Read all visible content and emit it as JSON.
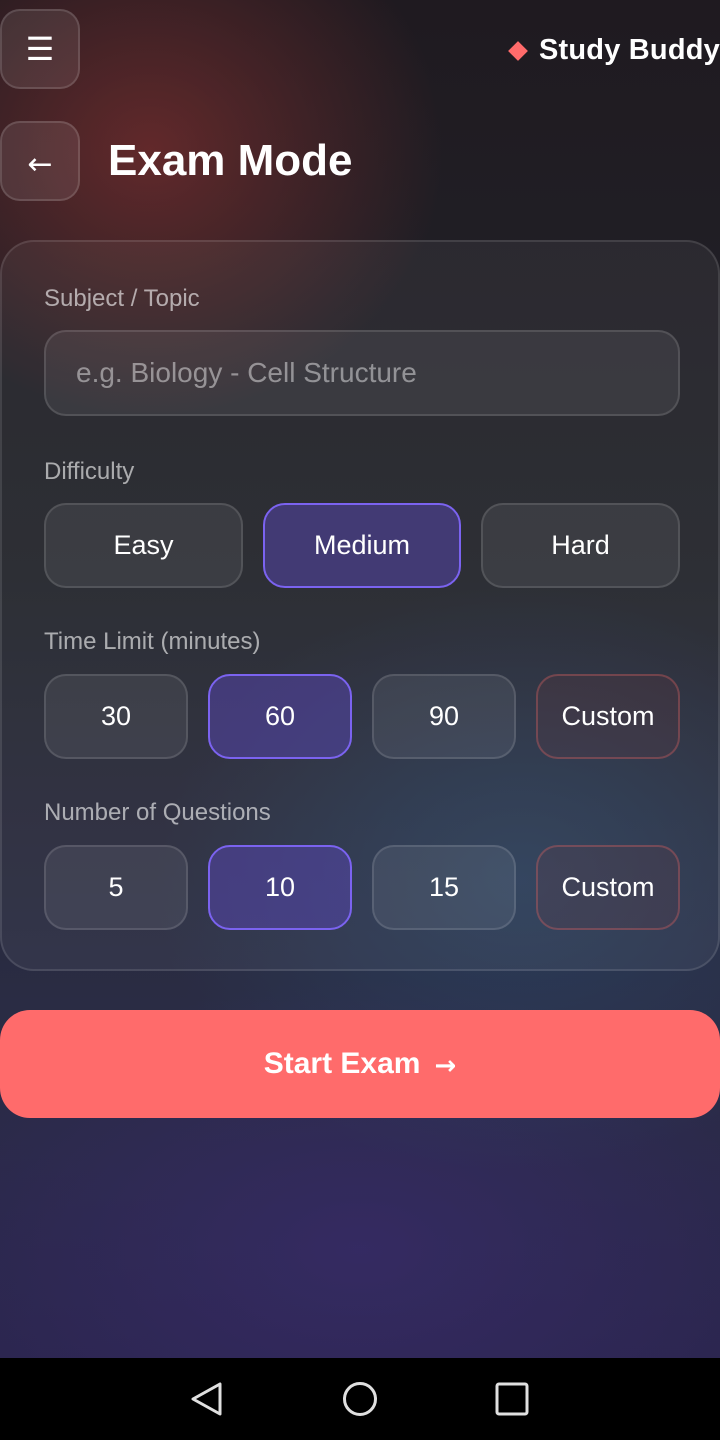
{
  "header": {
    "menu_icon": "☰",
    "brand_name": "Study Buddy",
    "accent_color": "#ff6b6b"
  },
  "page": {
    "back_icon": "←",
    "title": "Exam Mode"
  },
  "form": {
    "subject": {
      "label": "Subject / Topic",
      "placeholder": "e.g. Biology - Cell Structure",
      "value": ""
    },
    "difficulty": {
      "label": "Difficulty",
      "options": [
        "Easy",
        "Medium",
        "Hard"
      ],
      "selected": "Medium"
    },
    "time_limit": {
      "label": "Time Limit (minutes)",
      "options": [
        "30",
        "60",
        "90",
        "Custom"
      ],
      "selected": "60"
    },
    "questions": {
      "label": "Number of Questions",
      "options": [
        "5",
        "10",
        "15",
        "Custom"
      ],
      "selected": "10"
    },
    "selected_color": "#7b63f0"
  },
  "actions": {
    "start_label": "Start Exam",
    "start_arrow": "→"
  }
}
